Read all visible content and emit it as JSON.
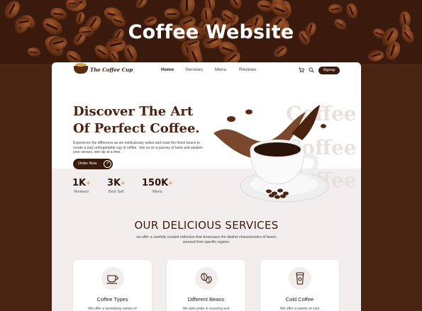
{
  "banner": {
    "title": "Coffee Website"
  },
  "nav": {
    "logo_text": "The Coffee Cup",
    "links": [
      "Home",
      "Services",
      "Menu",
      "Reviews"
    ],
    "signup_label": "Signup"
  },
  "hero": {
    "title_line1": "Discover The Art",
    "title_line2": "Of Perfect Coffee.",
    "description": "Experience the difference as we meticulously select and roast the finest beans to create a truly unforgettable cup of coffee. Join us on a journey of taste and awaken your senses, one sip at a time.",
    "order_label": "Order Now",
    "ghost_word": "Coffee",
    "stats": [
      {
        "value": "1K",
        "plus": "+",
        "label": "Reviews"
      },
      {
        "value": "3K",
        "plus": "+",
        "label": "Best Sell"
      },
      {
        "value": "150K",
        "plus": "+",
        "label": "Menu"
      }
    ]
  },
  "services": {
    "title": "OUR DELICIOUS SERVICES",
    "description": "we offer a carefully curated collection that showcases the distinct characteristics of beans sourced from specific regions.",
    "cards": [
      {
        "title": "Coffee Types",
        "text": "We offer a tantalizing variety of",
        "icon": "coffee-cup-icon"
      },
      {
        "title": "Different Beans",
        "text": "We take pride in sourcing and",
        "icon": "coffee-beans-icon"
      },
      {
        "title": "Cold Coffee",
        "text": "We offer a variety of cold",
        "icon": "cold-coffee-icon"
      }
    ]
  },
  "colors": {
    "brand_brown": "#3a1a0c",
    "accent_gold": "#c98f48",
    "section_bg": "#f3eeee"
  }
}
